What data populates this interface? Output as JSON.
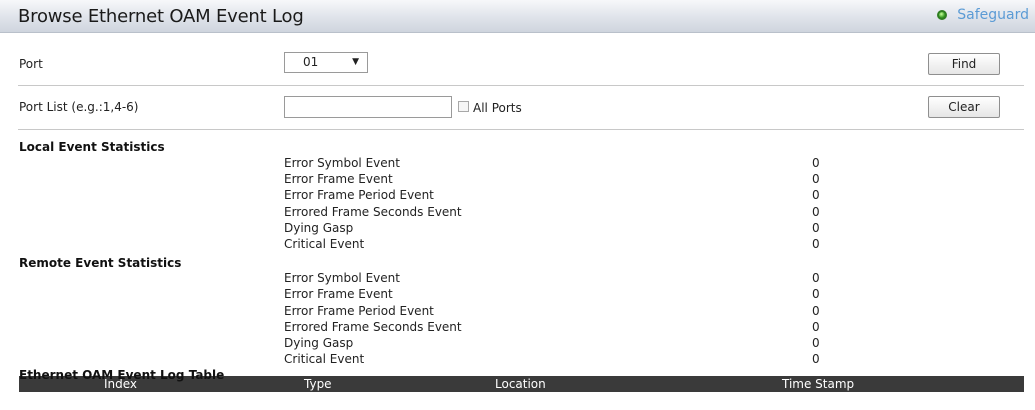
{
  "header": {
    "title": "Browse Ethernet OAM Event Log",
    "safeguard_label": "Safeguard"
  },
  "port": {
    "label": "Port",
    "selected": "01",
    "find_label": "Find"
  },
  "port_list": {
    "label": "Port List (e.g.:1,4-6)",
    "value": "",
    "all_ports_label": "All Ports",
    "clear_label": "Clear"
  },
  "local": {
    "title": "Local Event Statistics",
    "rows": [
      {
        "name": "Error Symbol Event",
        "value": "0"
      },
      {
        "name": "Error Frame Event",
        "value": "0"
      },
      {
        "name": "Error Frame Period Event",
        "value": "0"
      },
      {
        "name": "Errored Frame Seconds Event",
        "value": "0"
      },
      {
        "name": "Dying Gasp",
        "value": "0"
      },
      {
        "name": "Critical Event",
        "value": "0"
      }
    ]
  },
  "remote": {
    "title": "Remote Event Statistics",
    "rows": [
      {
        "name": "Error Symbol Event",
        "value": "0"
      },
      {
        "name": "Error Frame Event",
        "value": "0"
      },
      {
        "name": "Error Frame Period Event",
        "value": "0"
      },
      {
        "name": "Errored Frame Seconds Event",
        "value": "0"
      },
      {
        "name": "Dying Gasp",
        "value": "0"
      },
      {
        "name": "Critical Event",
        "value": "0"
      }
    ]
  },
  "log_table": {
    "title": "Ethernet OAM Event Log Table",
    "columns": [
      "Index",
      "Type",
      "Location",
      "Time Stamp"
    ]
  },
  "colors": {
    "accent": "#5b9bd5",
    "table_header_bg": "#3a3a3a"
  }
}
